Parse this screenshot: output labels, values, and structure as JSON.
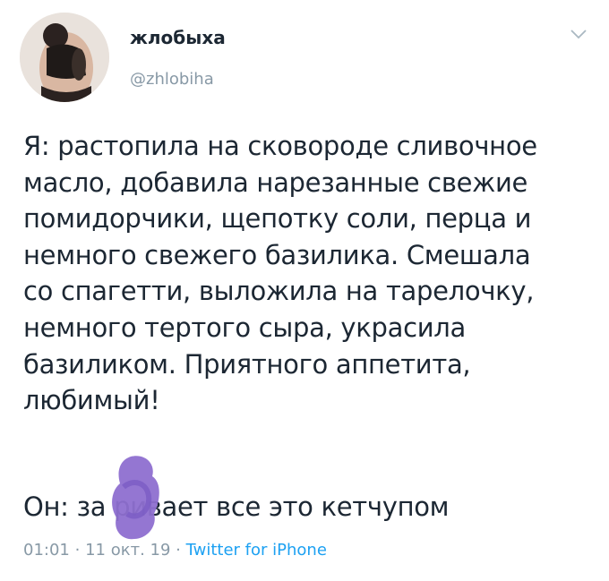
{
  "user": {
    "display_name": "жлобыха",
    "handle": "@zhlobiha"
  },
  "tweet": {
    "lines": [
      "Я: растопила на сковороде сливочное",
      "масло, добавила нарезанные свежие",
      "помидорчики, щепотку соли, перца и",
      "немного свежего базилика. Смешала",
      "со спагетти, выложила на тарелочку,",
      "немного тертого сыра, украсила",
      "базиликом. Приятного аппетита,",
      "любимый!"
    ],
    "reply_line": "Он: за   ривает все это кетчупом",
    "time": "01:01",
    "date": "11 окт. 19",
    "separator": "·",
    "source": "Twitter for iPhone"
  },
  "icons": {
    "menu": "chevron-down-icon",
    "avatar": "avatar",
    "redaction": "purple-scribble"
  },
  "colors": {
    "text": "#1c2733",
    "muted": "#8899a6",
    "link": "#1da1f2",
    "scribble": "#8e6fd0"
  }
}
